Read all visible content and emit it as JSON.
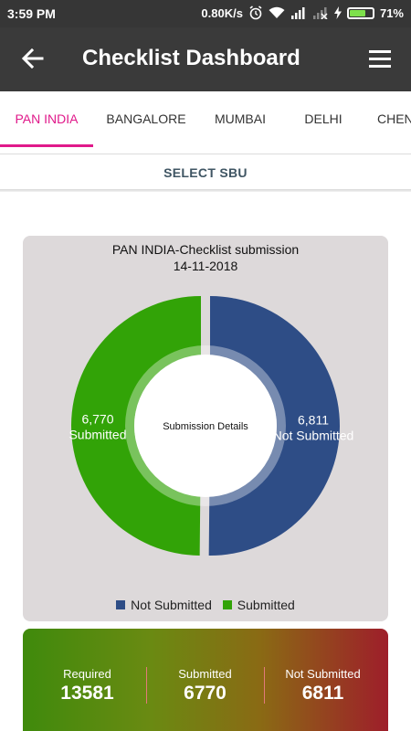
{
  "status_bar": {
    "time": "3:59 PM",
    "speed": "0.80K/s",
    "battery": "71%",
    "battery_level": 0.71
  },
  "app_bar": {
    "title": "Checklist Dashboard",
    "back_icon": "arrow-left-icon",
    "menu_icon": "hamburger-menu-icon"
  },
  "tabs": [
    {
      "label": "PAN INDIA",
      "active": true
    },
    {
      "label": "BANGALORE",
      "active": false
    },
    {
      "label": "MUMBAI",
      "active": false
    },
    {
      "label": "DELHI",
      "active": false
    },
    {
      "label": "CHEN",
      "active": false
    }
  ],
  "select_sbu_label": "SELECT SBU",
  "chart": {
    "title_line1": "PAN INDIA-Checklist submission",
    "title_line2": "14-11-2018",
    "center_label": "Submission Details"
  },
  "chart_data": {
    "type": "pie",
    "title": "PAN INDIA-Checklist submission",
    "subtitle": "14-11-2018",
    "categories": [
      "Not Submitted",
      "Submitted"
    ],
    "values": [
      6811,
      6770
    ],
    "value_labels": [
      "6,811",
      "6,770"
    ],
    "colors": [
      "#2e4d86",
      "#32a307"
    ],
    "legend": "bottom"
  },
  "summary": {
    "required_label": "Required",
    "required_value": "13581",
    "submitted_label": "Submitted",
    "submitted_value": "6770",
    "not_submitted_label": "Not Submitted",
    "not_submitted_value": "6811"
  }
}
